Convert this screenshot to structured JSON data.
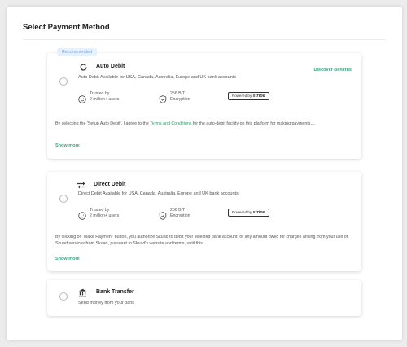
{
  "page": {
    "title": "Select Payment Method"
  },
  "auto_debit": {
    "tag": "Recommended",
    "name": "Auto Debit",
    "description": "Auto Debit Available for USA, Canada, Australia, Europe and UK bank accounts",
    "discover": "Discover Benefits",
    "trusted_line1": "Trusted by",
    "trusted_line2": "2 million+ users",
    "encryption_line1": "256 BIT",
    "encryption_line2": "Encryption",
    "powered_by": "Powered by",
    "stripe": "stripe",
    "consent_before": "By selecting the 'Setup Auto Debit', I agree to the ",
    "consent_link": "Terms and Conditions",
    "consent_after": " for the auto-debit facility on this platform for making payments....",
    "show_more": "Show more"
  },
  "direct_debit": {
    "name": "Direct Debit",
    "description": "Direct Debit Available for USA ,Canada, Australia, Europe and UK bank accounts",
    "trusted_line1": "Trusted by",
    "trusted_line2": "2 million+ users",
    "encryption_line1": "256 BIT",
    "encryption_line2": "Encryption",
    "powered_by": "Powered by",
    "stripe": "stripe",
    "consent": "By clicking on 'Make Payment' button, you authorize Skuad to debit your selected bank account for any amount owed for charges arising from your use of Skuad services from Skuad, pursuant to Skuad's website and terms, until this...",
    "show_more": "Show more"
  },
  "bank_transfer": {
    "name": "Bank Transfer",
    "description": "Send money from your bank"
  },
  "colors": {
    "accent": "#3aa57c",
    "tag_bg": "#e7f1fb",
    "tag_text": "#6aa2d6"
  }
}
